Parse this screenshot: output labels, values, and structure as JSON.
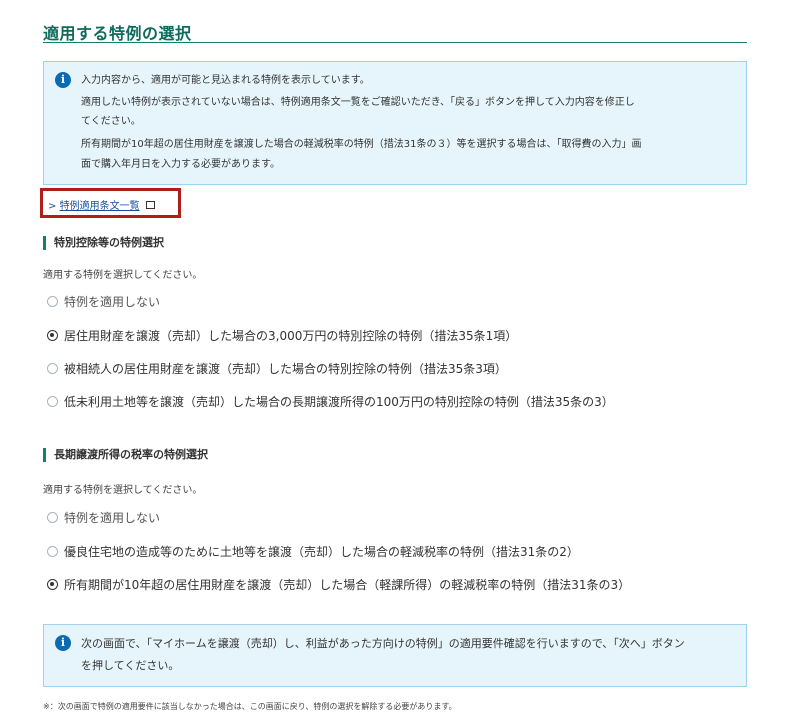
{
  "page_title": "適用する特例の選択",
  "info1": {
    "lines": [
      "入力内容から、適用が可能と見込まれる特例を表示しています。",
      "適用したい特例が表示されていない場合は、特例適用条文一覧をご確認いただき、「戻る」ボタンを押して入力内容を修正し",
      "てください。",
      "所有期間が10年超の居住用財産を譲渡した場合の軽減税率の特例（措法31条の３）等を選択する場合は、「取得費の入力」画",
      "面で購入年月日を入力する必要があります。"
    ]
  },
  "link": {
    "prefix": ">",
    "label": "特例適用条文一覧"
  },
  "section1": {
    "title": "特別控除等の特例選択",
    "hint": "適用する特例を選択してください。",
    "options": [
      {
        "label": "特例を適用しない",
        "selected": false
      },
      {
        "label": "居住用財産を譲渡（売却）した場合の3,000万円の特別控除の特例（措法35条1項）",
        "selected": true
      },
      {
        "label": "被相続人の居住用財産を譲渡（売却）した場合の特別控除の特例（措法35条3項）",
        "selected": false
      },
      {
        "label": "低未利用土地等を譲渡（売却）した場合の長期譲渡所得の100万円の特別控除の特例（措法35条の3）",
        "selected": false
      }
    ]
  },
  "section2": {
    "title": "長期譲渡所得の税率の特例選択",
    "hint": "適用する特例を選択してください。",
    "options": [
      {
        "label": "特例を適用しない",
        "selected": false
      },
      {
        "label": "優良住宅地の造成等のために土地等を譲渡（売却）した場合の軽減税率の特例（措法31条の2）",
        "selected": false
      },
      {
        "label": "所有期間が10年超の居住用財産を譲渡（売却）した場合（軽課所得）の軽減税率の特例（措法31条の3）",
        "selected": true
      }
    ]
  },
  "info2": {
    "lines": [
      "次の画面で、「マイホームを譲渡（売却）し、利益があった方向けの特例」の適用要件確認を行いますので、「次へ」ボタン",
      "を押してください。"
    ]
  },
  "footnote": "※：次の画面で特例の適用要件に該当しなかった場合は、この画面に戻り、特例の選択を解除する必要があります。",
  "colors": {
    "title": "#0d6b5c",
    "info_bg": "#e6f5fc",
    "info_icon": "#0a6bb3",
    "highlight_frame": "#b01d1d"
  }
}
